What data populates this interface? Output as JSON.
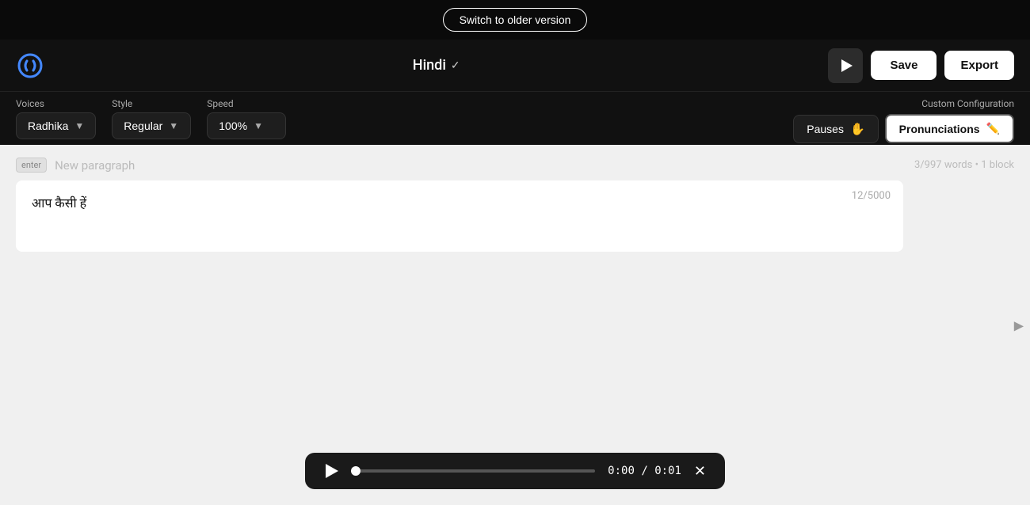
{
  "topBanner": {
    "switchBtn": "Switch to older version"
  },
  "header": {
    "logoAlt": "App logo",
    "language": "Hindi",
    "saveBtn": "Save",
    "exportBtn": "Export"
  },
  "controls": {
    "voicesLabel": "Voices",
    "voicesValue": "Radhika",
    "styleLabel": "Style",
    "styleValue": "Regular",
    "speedLabel": "Speed",
    "speedValue": "100%",
    "customConfigLabel": "Custom Configuration",
    "pausesBtn": "Pauses",
    "pronunciationsBtn": "Pronunciations"
  },
  "editor": {
    "enterBadge": "enter",
    "newParagraphPlaceholder": "New paragraph",
    "wordCount": "3/997 words",
    "blockCount": "1 block",
    "textContent": "आप कैसी हें",
    "charCount": "12/5000"
  },
  "player": {
    "currentTime": "0:00",
    "totalTime": "0:01",
    "separator": "/"
  }
}
